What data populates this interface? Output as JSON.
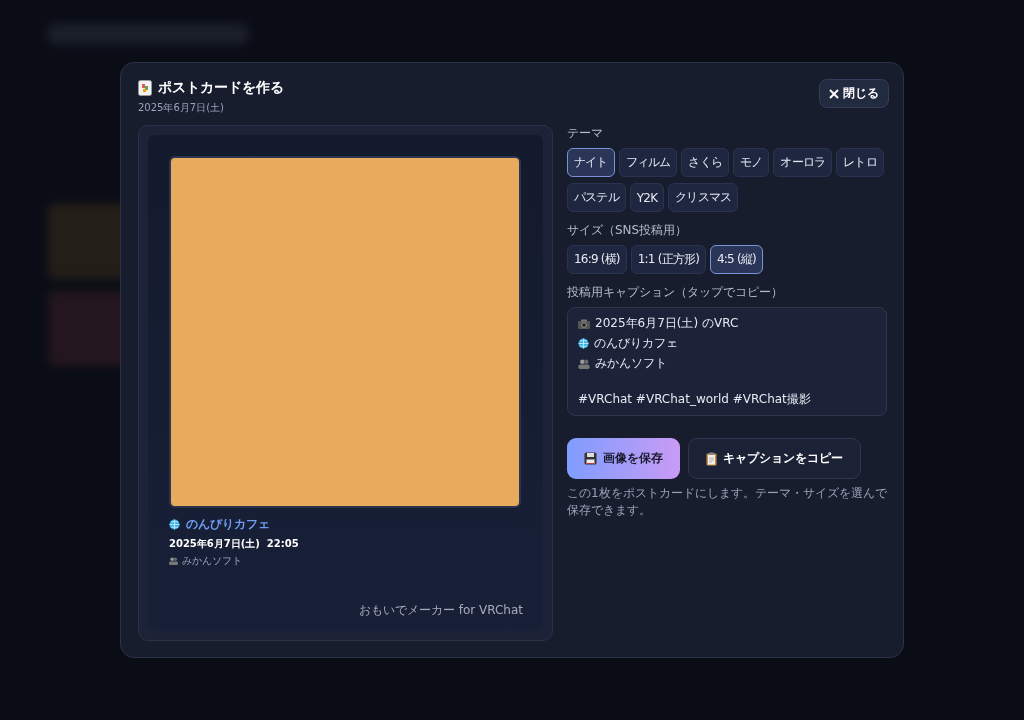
{
  "dialog": {
    "title": "ポストカードを作る",
    "date": "2025年6月7日(土)",
    "close_label": "閉じる"
  },
  "preview": {
    "world": "のんびりカフェ",
    "datetime": "2025年6月7日(土)  22:05",
    "author": "みかんソフト",
    "footer": "おもいでメーカー for VRChat"
  },
  "theme": {
    "label": "テーマ",
    "options": [
      {
        "label": "ナイト",
        "selected": true
      },
      {
        "label": "フィルム",
        "selected": false
      },
      {
        "label": "さくら",
        "selected": false
      },
      {
        "label": "モノ",
        "selected": false
      },
      {
        "label": "オーロラ",
        "selected": false
      },
      {
        "label": "レトロ",
        "selected": false
      },
      {
        "label": "パステル",
        "selected": false
      },
      {
        "label": "Y2K",
        "selected": false
      },
      {
        "label": "クリスマス",
        "selected": false
      }
    ]
  },
  "size": {
    "label": "サイズ（SNS投稿用）",
    "options": [
      {
        "label": "16:9 (横)",
        "selected": false
      },
      {
        "label": "1:1 (正方形)",
        "selected": false
      },
      {
        "label": "4:5 (縦)",
        "selected": true
      }
    ]
  },
  "caption": {
    "label": "投稿用キャプション（タップでコピー）",
    "lines": [
      {
        "kind": "camera",
        "text": "2025年6月7日(土) のVRC"
      },
      {
        "kind": "globe",
        "text": "のんびりカフェ"
      },
      {
        "kind": "people",
        "text": "みかんソフト"
      },
      {
        "kind": "blank"
      },
      {
        "kind": "plain",
        "text": "#VRChat #VRChat_world #VRChat撮影"
      }
    ]
  },
  "actions": {
    "save": "画像を保存",
    "copy": "キャプションをコピー",
    "hint": "この1枚をポストカードにします。テーマ・サイズを選んで保存できます。"
  }
}
